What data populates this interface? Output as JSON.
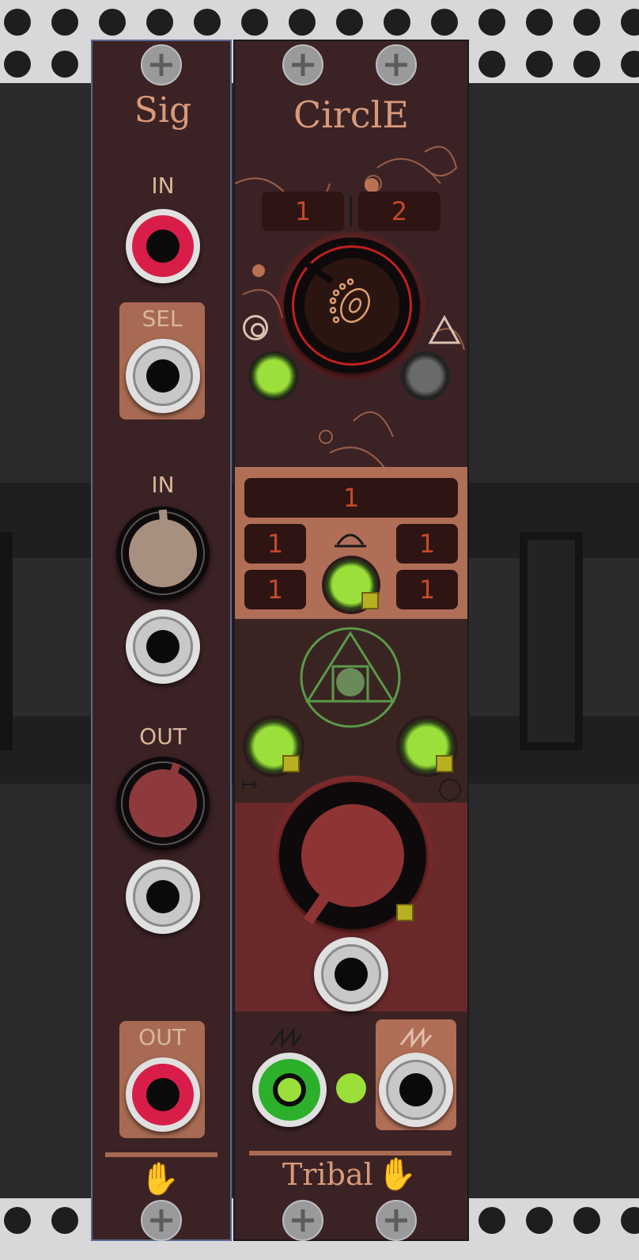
{
  "sig": {
    "title": "Sig",
    "in_label": "IN",
    "sel_label": "SEL",
    "in2_label": "IN",
    "out_label": "OUT",
    "out2_label": "OUT"
  },
  "circle": {
    "title": "CirclE",
    "display_left": "1",
    "display_right": "2",
    "display_main": "1",
    "display_tl": "1",
    "display_tr": "1",
    "display_bl": "1",
    "display_br": "1",
    "brand": "Tribal"
  },
  "colors": {
    "panel": "#3b2225",
    "label": "#d8b79a",
    "display_text": "#c24a2a",
    "led_green": "#9be03a",
    "jack_red": "#d81e48"
  }
}
